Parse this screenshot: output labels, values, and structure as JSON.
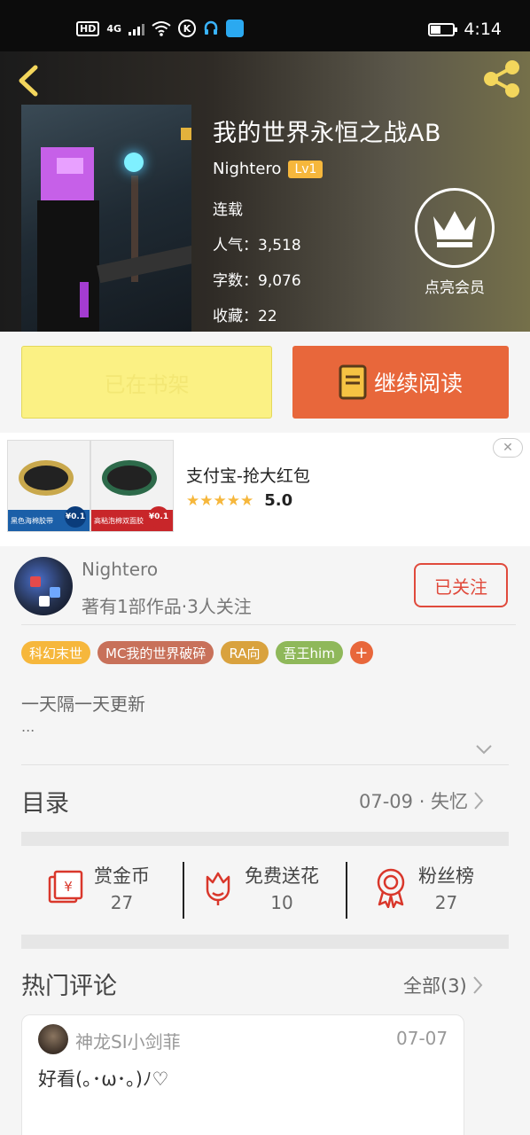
{
  "status_bar": {
    "hd": "HD",
    "signal": "4G",
    "time": "4:14"
  },
  "book": {
    "title": "我的世界永恒之战AB",
    "author": "Nightero",
    "level": "Lv1",
    "status": "连载",
    "popularity": "人气：3,518",
    "word_count": "字数：9,076",
    "favorites": "收藏：22",
    "vip_label": "点亮会员"
  },
  "actions": {
    "shelf_label": "已在书架",
    "read_label": "继续阅读"
  },
  "ad": {
    "title": "支付宝-抢大红包",
    "stars": "★★★★★",
    "score": "5.0",
    "close": "✕",
    "images": [
      {
        "caption": "黑色海棉胶带",
        "price": "¥0.1"
      },
      {
        "caption": "高粘泡棉双面胶",
        "price": "¥0.1"
      }
    ]
  },
  "author_card": {
    "name": "Nightero",
    "info": "著有1部作品·3人关注",
    "follow_label": "已关注"
  },
  "tags": [
    {
      "label": "科幻末世",
      "color": "#f6b73c"
    },
    {
      "label": "MC我的世界破碎",
      "color": "#c8715a"
    },
    {
      "label": "RA向",
      "color": "#d9a23e"
    },
    {
      "label": "吾王him",
      "color": "#8fb85a"
    }
  ],
  "tag_plus": "+",
  "description": {
    "text": "一天隔一天更新",
    "more": "..."
  },
  "toc": {
    "title": "目录",
    "latest": "07-09 · 失忆"
  },
  "stats": [
    {
      "label": "赏金币",
      "value": "27",
      "icon": "red-envelope-icon"
    },
    {
      "label": "免费送花",
      "value": "10",
      "icon": "flower-icon"
    },
    {
      "label": "粉丝榜",
      "value": "27",
      "icon": "medal-icon"
    }
  ],
  "comments": {
    "title": "热门评论",
    "all_label": "全部(3)",
    "items": [
      {
        "user": "神龙SI小剑菲",
        "date": "07-07",
        "text": "好看(｡･ω･｡)ﾉ♡"
      }
    ]
  },
  "colors": {
    "accent": "#e8673b",
    "shelf": "#fbf184",
    "follow": "#e04a3c",
    "badge": "#f6b73c"
  }
}
